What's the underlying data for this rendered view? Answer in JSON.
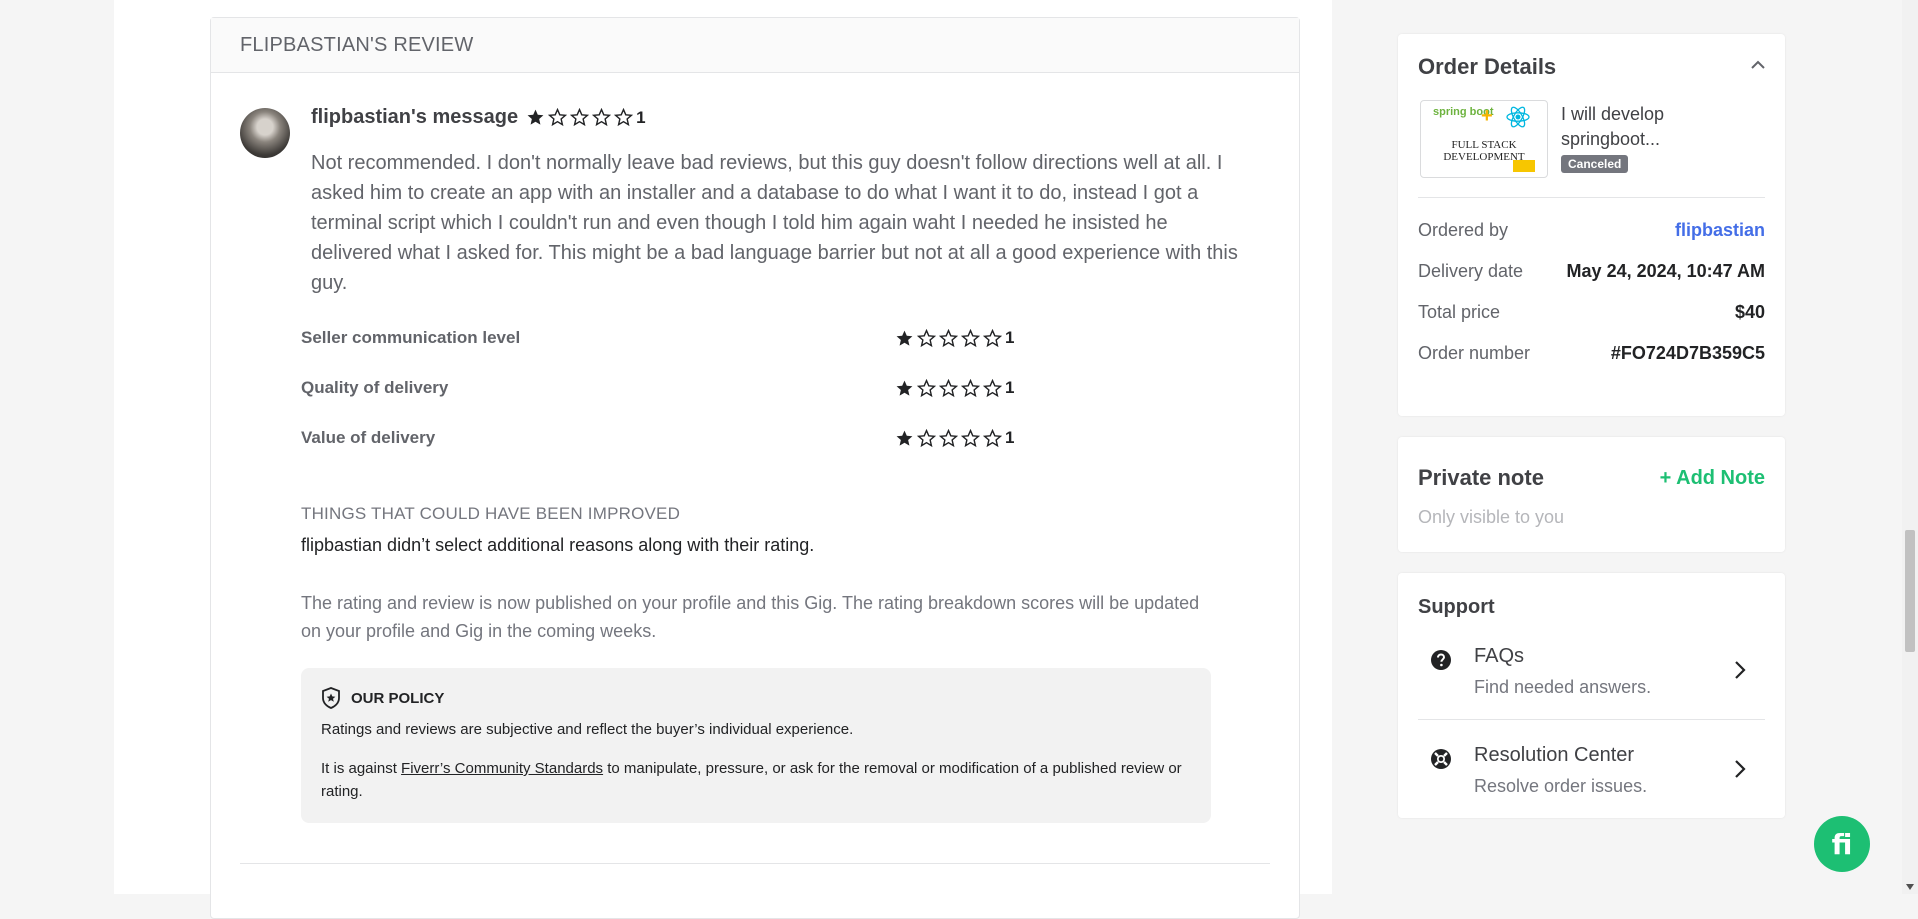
{
  "review": {
    "header": "FLIPBASTIAN'S REVIEW",
    "message_title": "flipbastian's message",
    "message_rating": "1",
    "message_body": "Not recommended. I don't normally leave bad reviews, but this guy doesn't follow directions well at all. I asked him to create an app with an installer and a database to do what I want it to do, instead I got a terminal script which I couldn't run and even though I told him again waht I needed he insisted he delivered what I asked for. This might be a bad language barrier but not at all a good experience with this guy.",
    "ratings": [
      {
        "label": "Seller communication level",
        "value": "1",
        "stars": 1
      },
      {
        "label": "Quality of delivery",
        "value": "1",
        "stars": 1
      },
      {
        "label": "Value of delivery",
        "value": "1",
        "stars": 1
      }
    ],
    "improve_title": "THINGS THAT COULD HAVE BEEN IMPROVED",
    "improve_text": "flipbastian didn’t select additional reasons along with their rating.",
    "published_text": "The rating and review is now published on your profile and this Gig. The rating breakdown scores will be updated on your profile and Gig in the coming weeks.",
    "policy": {
      "title": "OUR POLICY",
      "p1": "Ratings and reviews are subjective and reflect the buyer’s individual experience.",
      "p2_before": "It is against ",
      "p2_link": "Fiverr’s Community Standards",
      "p2_after": " to manipulate, pressure, or ask for the removal or modification of a published review or rating."
    }
  },
  "order_details": {
    "title": "Order Details",
    "thumb_top": "spring boot",
    "thumb_caption": "FULL STACK DEVELOPMENT",
    "gig_title": "I will develop springboot...",
    "status": "Canceled",
    "rows": [
      {
        "key": "Ordered by",
        "value": "flipbastian"
      },
      {
        "key": "Delivery date",
        "value": "May 24, 2024, 10:47 AM"
      },
      {
        "key": "Total price",
        "value": "$40"
      },
      {
        "key": "Order number",
        "value": "#FO724D7B359C5"
      }
    ]
  },
  "private_note": {
    "title": "Private note",
    "add_label": "+ Add Note",
    "subtitle": "Only visible to you"
  },
  "support": {
    "title": "Support",
    "items": [
      {
        "name": "FAQs",
        "desc": "Find needed answers."
      },
      {
        "name": "Resolution Center",
        "desc": "Resolve order issues."
      }
    ]
  },
  "chat_button_label": "fi",
  "colors": {
    "brand": "#1dbf73",
    "link": "#446ee7",
    "star": "#222325"
  }
}
